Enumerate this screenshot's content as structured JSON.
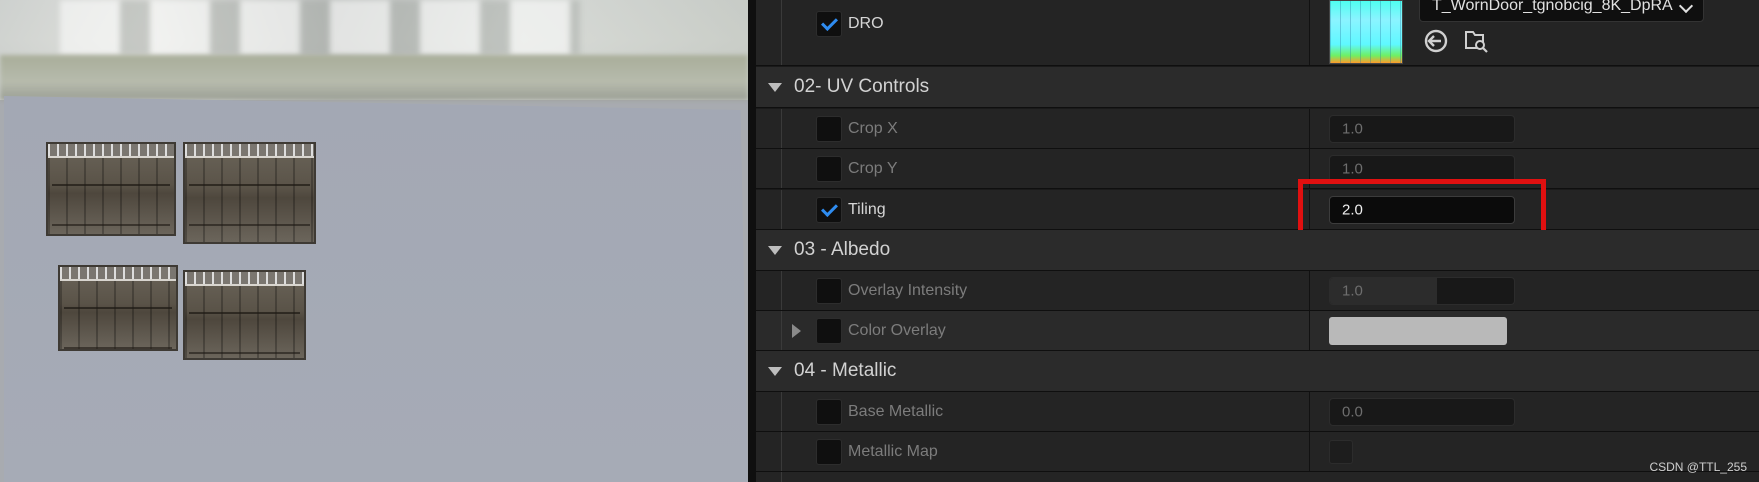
{
  "properties": {
    "dro": {
      "label": "DRO",
      "checked": true,
      "texture_asset": "T_WornDoor_tgnobcig_8K_DpRA"
    },
    "uv_controls": {
      "title": "02- UV Controls",
      "crop_x": {
        "label": "Crop X",
        "value": "1.0",
        "checked": false
      },
      "crop_y": {
        "label": "Crop Y",
        "value": "1.0",
        "checked": false
      },
      "tiling": {
        "label": "Tiling",
        "value": "2.0",
        "checked": true
      }
    },
    "albedo": {
      "title": "03 - Albedo",
      "overlay_intensity": {
        "label": "Overlay Intensity",
        "value": "1.0",
        "slider_fraction": 0.58
      },
      "color_overlay": {
        "label": "Color Overlay",
        "color": "#b9b9b9"
      }
    },
    "metallic": {
      "title": "04 - Metallic",
      "base_metallic": {
        "label": "Base Metallic",
        "value": "0.0"
      },
      "metallic_map": {
        "label": "Metallic Map"
      }
    }
  },
  "watermark": "CSDN @TTL_255",
  "colors": {
    "highlight": "#e01010",
    "check_accent": "#2f8cf0",
    "panel_bg": "#242424"
  }
}
